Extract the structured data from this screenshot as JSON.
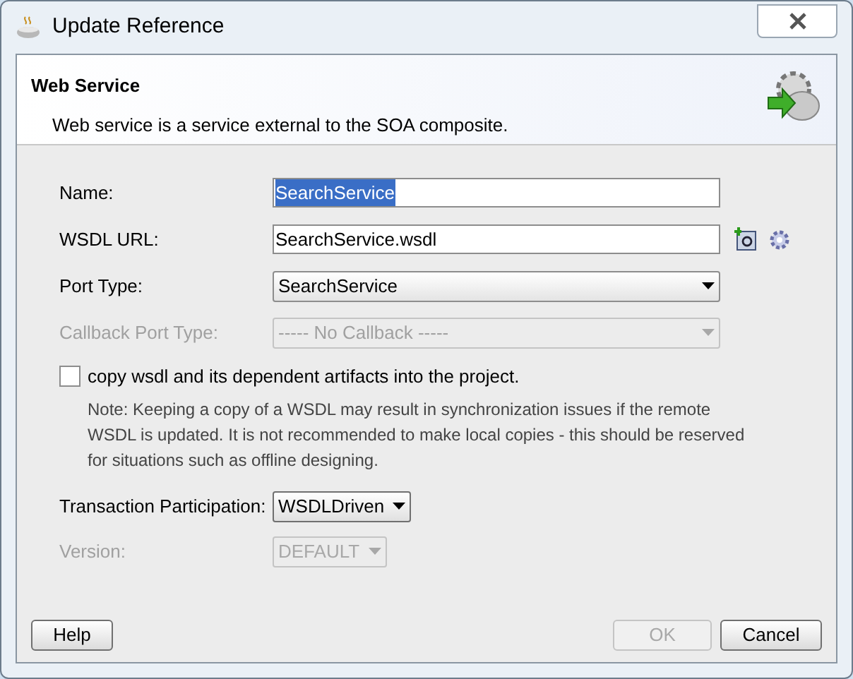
{
  "window": {
    "title": "Update Reference"
  },
  "header": {
    "title": "Web Service",
    "description": "Web service is a service external to the SOA composite."
  },
  "fields": [
    {
      "label": "Name:",
      "kind": "text",
      "value": "SearchService",
      "text_selected": true
    },
    {
      "label": "WSDL URL:",
      "kind": "text_browse",
      "value": "SearchService.wsdl",
      "text_selected": false
    },
    {
      "label": "Port Type:",
      "kind": "dropdown",
      "value": "SearchService",
      "disabled": false
    },
    {
      "label": "Callback Port Type:",
      "kind": "dropdown",
      "value": "----- No Callback -----",
      "disabled": true
    }
  ],
  "copy_option": {
    "label": "copy wsdl and its dependent artifacts into the project.",
    "checked": false,
    "note": "Note: Keeping a copy of a WSDL may result in synchronization issues if the remote WSDL is updated. It is not recommended to make local copies - this should be reserved for situations such as offline designing."
  },
  "options": [
    {
      "label": "Transaction Participation:",
      "value": "WSDLDriven",
      "disabled": false
    },
    {
      "label": "Version:",
      "value": "DEFAULT",
      "disabled": true
    }
  ],
  "buttons": [
    {
      "label": "Help",
      "disabled": false
    },
    {
      "label": "OK",
      "disabled": true
    },
    {
      "label": "Cancel",
      "disabled": false
    }
  ]
}
